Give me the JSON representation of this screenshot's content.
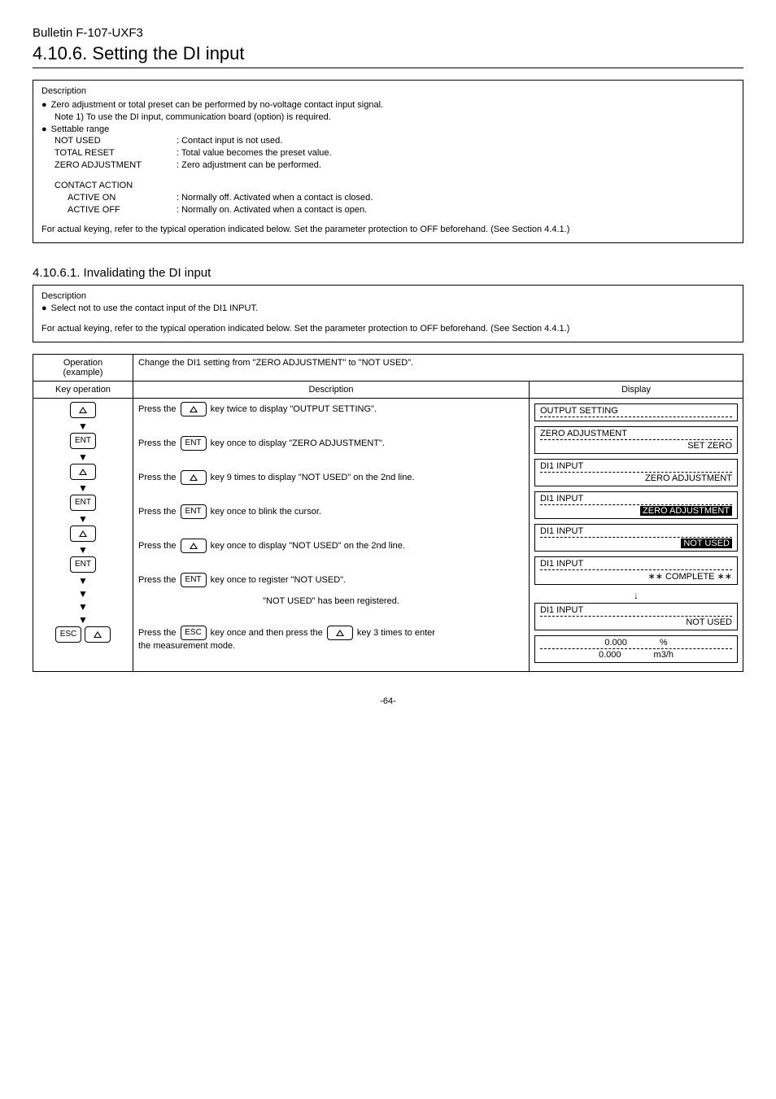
{
  "bulletin": "Bulletin F-107-UXF3",
  "section_title": "4.10.6. Setting the DI input",
  "desc": {
    "title": "Description",
    "bullet1": "Zero adjustment or total preset can be performed by no-voltage contact input signal.",
    "note1": "Note 1) To use the DI input, communication board (option) is required.",
    "settable": "Settable range",
    "ranges": [
      {
        "k": "NOT USED",
        "v": ": Contact input is not used."
      },
      {
        "k": "TOTAL RESET",
        "v": ": Total value becomes the preset value."
      },
      {
        "k": "ZERO ADJUSTMENT",
        "v": ": Zero adjustment can be performed."
      }
    ],
    "contact_title": "CONTACT ACTION",
    "contacts": [
      {
        "k": "ACTIVE ON",
        "v": ": Normally off. Activated when a contact is closed."
      },
      {
        "k": "ACTIVE OFF",
        "v": ": Normally on. Activated when a contact is open."
      }
    ],
    "footnote": "For actual keying, refer to the typical operation indicated below. Set the parameter protection to OFF beforehand. (See Section 4.4.1.)"
  },
  "sub_title": "4.10.6.1. Invalidating the DI input",
  "sub_desc": {
    "title": "Description",
    "bullet": "Select not to use the contact input of the DI1 INPUT.",
    "footnote": "For actual keying, refer to the typical operation indicated below. Set the parameter protection to OFF beforehand. (See Section 4.4.1.)"
  },
  "table": {
    "op_example_l1": "Operation",
    "op_example_l2": "(example)",
    "change_text": "Change the DI1 setting from \"ZERO ADJUSTMENT\" to \"NOT USED\".",
    "key_op_header": "Key operation",
    "desc_header": "Description",
    "disp_header": "Display",
    "rows": [
      {
        "key": "up",
        "desc_pre": "Press the ",
        "desc_key": "up",
        "desc_post": " key twice to display \"OUTPUT SETTING\".",
        "disp_l1": "OUTPUT SETTING",
        "disp_l2": "",
        "inv": false
      },
      {
        "key": "ent",
        "desc_pre": "Press the ",
        "desc_key": "ENT",
        "desc_post": " key once to display \"ZERO ADJUSTMENT\".",
        "disp_l1": "ZERO ADJUSTMENT",
        "disp_l2": "SET ZERO",
        "inv": false
      },
      {
        "key": "up",
        "desc_pre": "Press the ",
        "desc_key": "up",
        "desc_post": " key 9 times to display \"NOT USED\" on the 2nd line.",
        "disp_l1": "DI1 INPUT",
        "disp_l2": "ZERO ADJUSTMENT",
        "inv": false
      },
      {
        "key": "ent",
        "desc_pre": "Press the ",
        "desc_key": "ENT",
        "desc_post": " key once to blink the cursor.",
        "disp_l1": "DI1 INPUT",
        "disp_l2": "ZERO ADJUSTMENT",
        "inv": true
      },
      {
        "key": "up",
        "desc_pre": "Press the ",
        "desc_key": "up",
        "desc_post": " key once to display \"NOT USED\" on the 2nd line.",
        "disp_l1": "DI1 INPUT",
        "disp_l2": "NOT USED",
        "inv": true
      }
    ],
    "register_row": {
      "key": "ent",
      "desc_pre": "Press the ",
      "desc_key": "ENT",
      "desc_post": " key once to register \"NOT USED\".",
      "registered": "\"NOT USED\" has been registered.",
      "disp1_l1": "DI1 INPUT",
      "disp1_l2": "∗∗ COMPLETE ∗∗",
      "arrow": "↓",
      "disp2_l1": "DI1 INPUT",
      "disp2_l2": "NOT USED"
    },
    "final_row": {
      "desc_pre": "Press the ",
      "desc_key1": "ESC",
      "desc_mid": " key once and then press the ",
      "desc_key2": "up",
      "desc_post": " key 3 times to enter",
      "desc_line2": "the measurement mode.",
      "disp_l1_left": "0.000",
      "disp_l1_right": "%",
      "disp_l2_left": "0.000",
      "disp_l2_right": "m3/h"
    }
  },
  "page": "-64-",
  "key_labels": {
    "ent": "ENT",
    "esc": "ESC"
  }
}
